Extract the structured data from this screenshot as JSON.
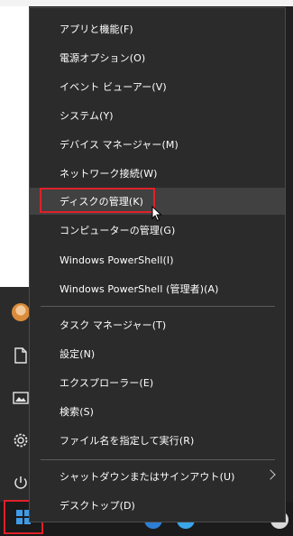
{
  "menu": {
    "items": [
      {
        "label": "アプリと機能(F)"
      },
      {
        "label": "電源オプション(O)"
      },
      {
        "label": "イベント ビューアー(V)"
      },
      {
        "label": "システム(Y)"
      },
      {
        "label": "デバイス マネージャー(M)"
      },
      {
        "label": "ネットワーク接続(W)"
      },
      {
        "label": "ディスクの管理(K)"
      },
      {
        "label": "コンピューターの管理(G)"
      },
      {
        "label": "Windows PowerShell(I)"
      },
      {
        "label": "Windows PowerShell (管理者)(A)"
      },
      {
        "label": "タスク マネージャー(T)"
      },
      {
        "label": "設定(N)"
      },
      {
        "label": "エクスプローラー(E)"
      },
      {
        "label": "検索(S)"
      },
      {
        "label": "ファイル名を指定して実行(R)"
      },
      {
        "label": "シャットダウンまたはサインアウト(U)"
      },
      {
        "label": "デスクトップ(D)"
      }
    ],
    "highlighted_item": "ディスクの管理(K)"
  },
  "colors": {
    "menu_bg": "#2b2b2b",
    "hover_bg": "#414141",
    "highlight_border": "#e0202a",
    "text": "#ffffff",
    "start_logo": "#3f9be6"
  },
  "icons": [
    "user-avatar-icon",
    "document-icon",
    "picture-icon",
    "settings-gear-icon",
    "power-icon",
    "windows-start-icon",
    "mouse-cursor-icon",
    "chevron-right-icon"
  ]
}
